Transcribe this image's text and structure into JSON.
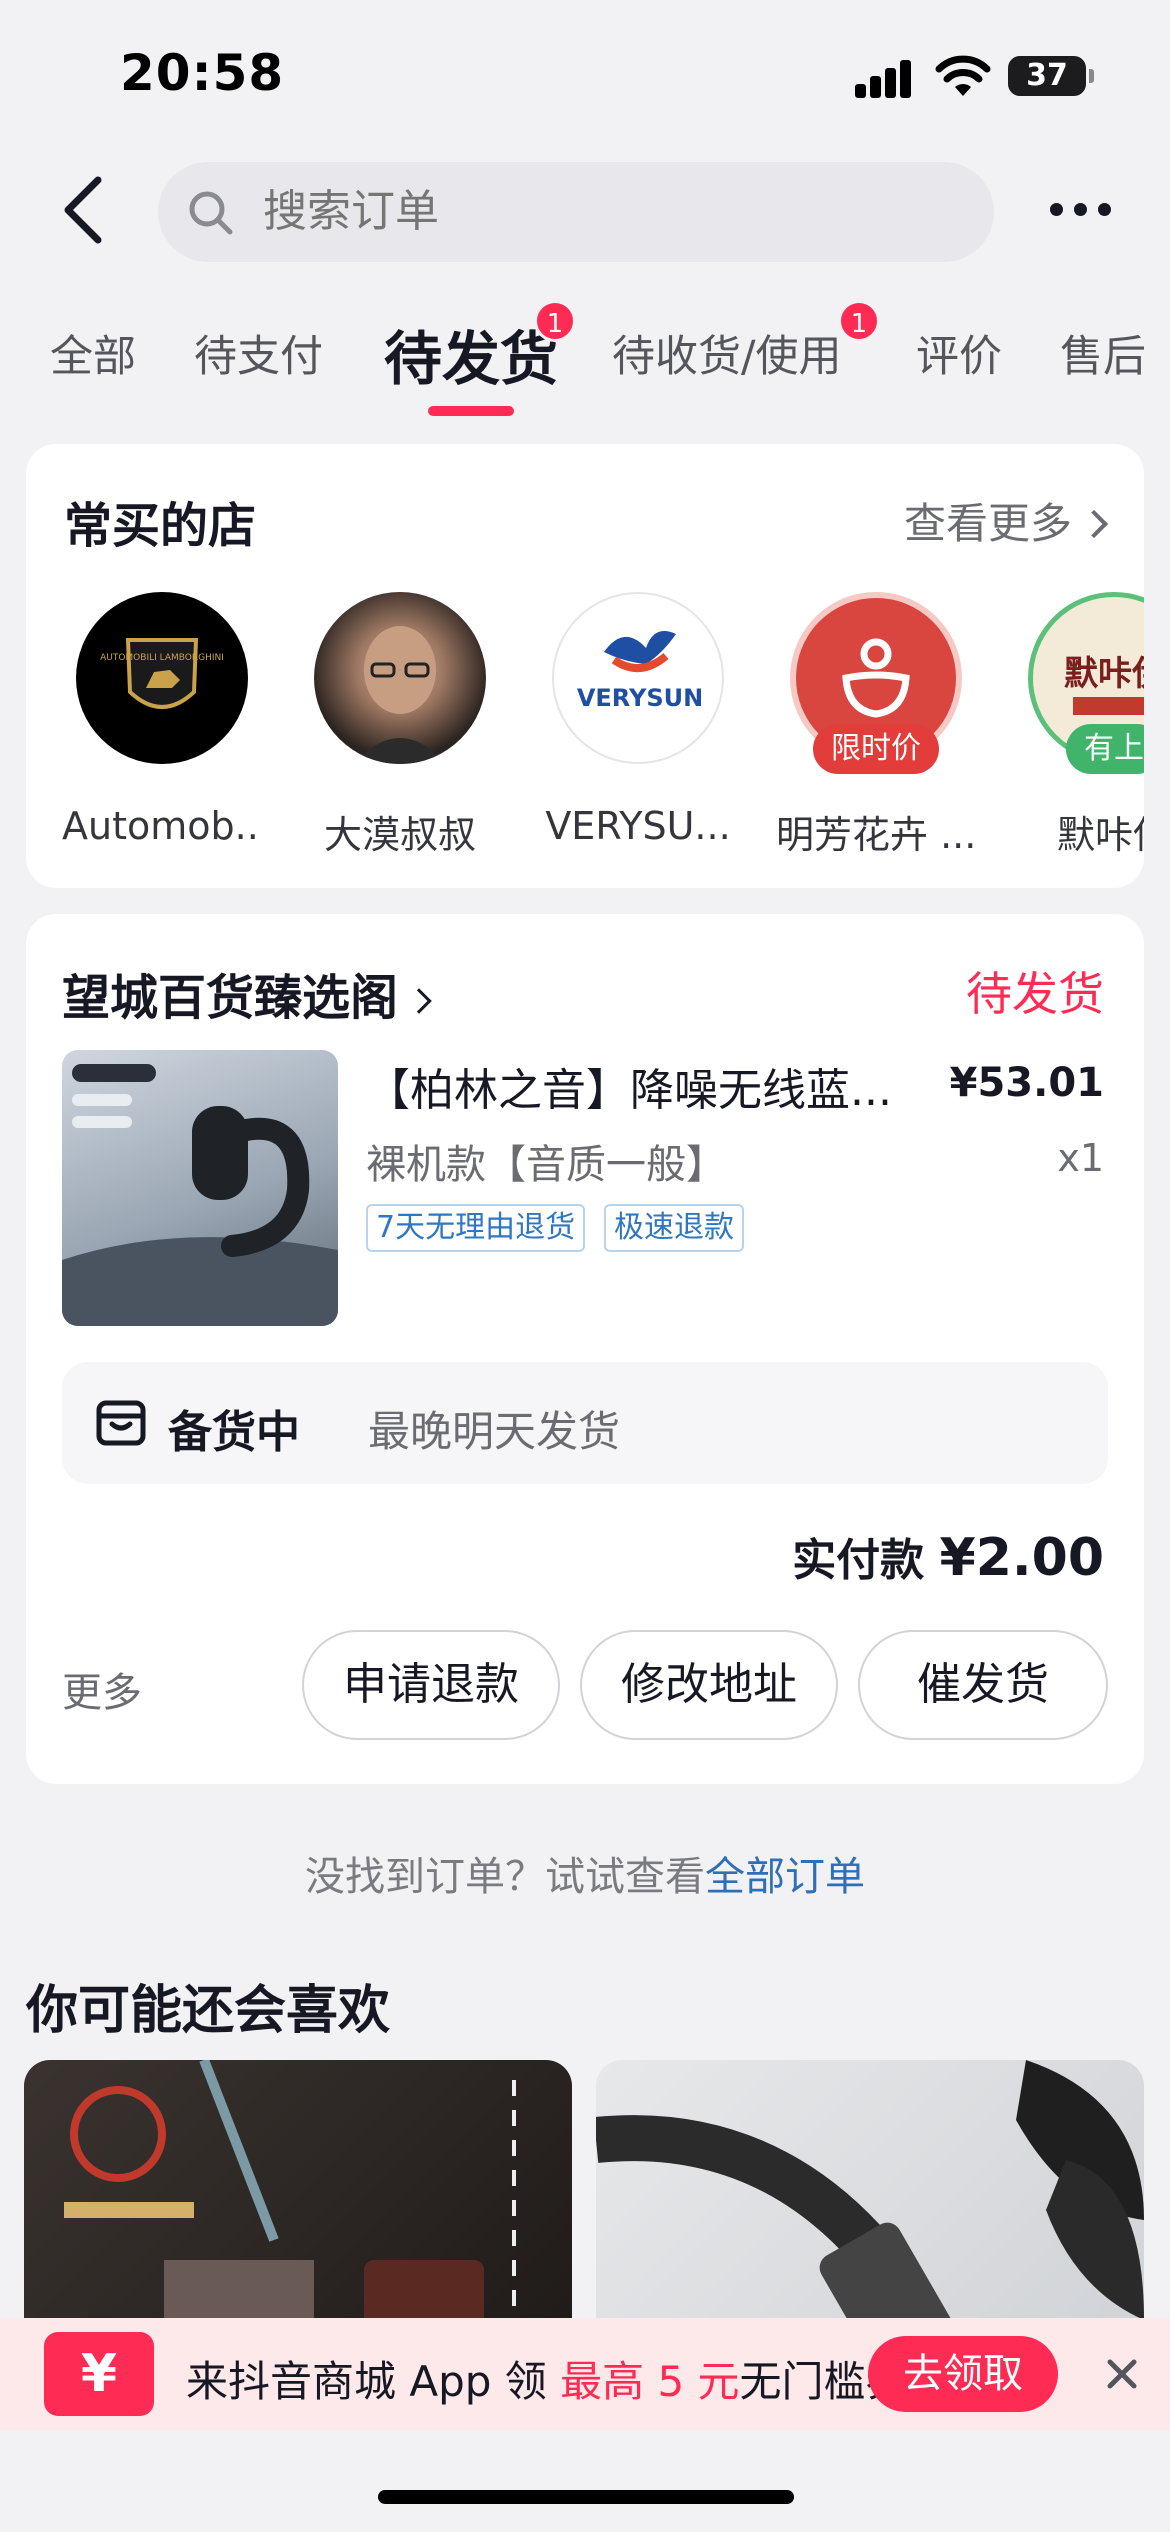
{
  "status_bar": {
    "time": "20:58",
    "battery": "37"
  },
  "search": {
    "placeholder": "搜索订单"
  },
  "tabs": [
    {
      "label": "全部"
    },
    {
      "label": "待支付"
    },
    {
      "label": "待发货",
      "badge": "1",
      "active": true
    },
    {
      "label": "待收货/使用",
      "badge": "1"
    },
    {
      "label": "评价"
    },
    {
      "label": "售后"
    }
  ],
  "frequent_shops": {
    "title": "常买的店",
    "more_label": "查看更多",
    "shops": [
      {
        "name": "Automob...",
        "logo_text": "AUTOMOBILI LAMBORGHINI"
      },
      {
        "name": "大漠叔叔"
      },
      {
        "name": "VERYSU...",
        "logo_text": "VERYSUN"
      },
      {
        "name": "明芳花卉 ...",
        "tag": "限时价"
      },
      {
        "name": "默咔伊",
        "logo_text": "默咔伊",
        "tag": "有上"
      }
    ]
  },
  "order": {
    "store_name": "望城百货臻选阁",
    "status": "待发货",
    "product": {
      "title": "【柏林之音】降噪无线蓝...",
      "price": "¥53.01",
      "spec": "裸机款【音质一般】",
      "qty": "x1",
      "service_tags": [
        "7天无理由退货",
        "极速退款"
      ]
    },
    "stock_label": "备货中",
    "stock_desc": "最晚明天发货",
    "paid_label": "实付款",
    "paid_amount": "¥2.00",
    "more_label": "更多",
    "actions": [
      "申请退款",
      "修改地址",
      "催发货"
    ]
  },
  "not_found": {
    "text": "没找到订单？试试查看",
    "link": "全部订单"
  },
  "recommend": {
    "title": "你可能还会喜欢"
  },
  "promo": {
    "icon": "¥",
    "text_before": "来抖音商城 App 领 ",
    "highlight": "最高 5 元",
    "text_after": "无门槛券",
    "button": "去领取"
  },
  "colors": {
    "accent": "#fe2c55",
    "link": "#2f6fb8"
  }
}
